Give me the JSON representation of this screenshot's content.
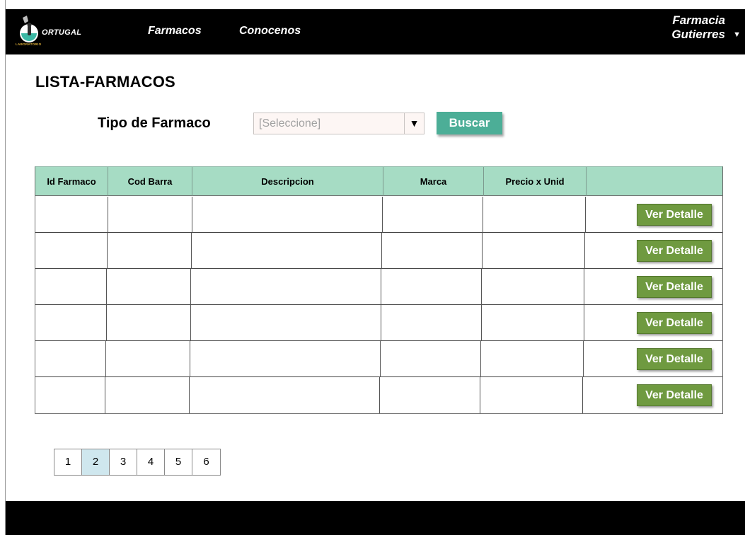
{
  "topbar": {
    "logo_text": "ORTUGAL",
    "logo_subtext": "LABORATORIO",
    "nav": [
      {
        "label": "Farmacos"
      },
      {
        "label": "Conocenos"
      }
    ],
    "account_line1": "Farmacia",
    "account_line2": "Gutierres",
    "account_caret": "▼"
  },
  "page": {
    "title": "LISTA-FARMACOS"
  },
  "filter": {
    "label": "Tipo de Farmaco",
    "select_placeholder": "[Seleccione]",
    "select_arrow": "▼",
    "search_label": "Buscar"
  },
  "table": {
    "columns": [
      "Id Farmaco",
      "Cod Barra",
      "Descripcion",
      "Marca",
      "Precio x Unid",
      ""
    ],
    "rows": [
      {
        "action": "Ver Detalle"
      },
      {
        "action": "Ver Detalle"
      },
      {
        "action": "Ver Detalle"
      },
      {
        "action": "Ver Detalle"
      },
      {
        "action": "Ver Detalle"
      },
      {
        "action": "Ver Detalle"
      }
    ]
  },
  "pagination": {
    "pages": [
      "1",
      "2",
      "3",
      "4",
      "5",
      "6"
    ],
    "current": "2"
  },
  "colors": {
    "header_bg": "#000000",
    "table_header": "#a6dcc4",
    "search_button": "#4cae97",
    "detail_button": "#6f9a40",
    "active_page": "#cfe7ee"
  }
}
